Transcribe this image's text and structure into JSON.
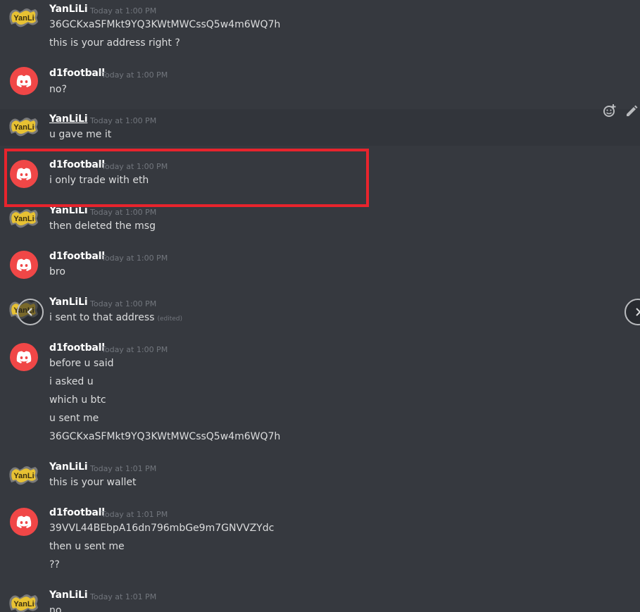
{
  "users": {
    "yanlili": {
      "name": "YanLiLi",
      "avatar_icon": "yanlili-logo-icon"
    },
    "d1football": {
      "name": "d1football",
      "avatar_icon": "discord-logo-icon"
    }
  },
  "messages": [
    {
      "author": "YanLiLi",
      "time": "Today at 1:00 PM",
      "lines": [
        "36GCKxaSFMkt9YQ3KWtMWCssQ5w4m6WQ7h",
        "this is your address right ?"
      ]
    },
    {
      "author": "d1football",
      "time": "Today at 1:00 PM",
      "lines": [
        "no?"
      ]
    },
    {
      "author": "YanLiLi",
      "time": "Today at 1:00 PM",
      "lines": [
        "u gave me it"
      ]
    },
    {
      "author": "d1football",
      "time": "Today at 1:00 PM",
      "lines": [
        "i only trade with eth"
      ]
    },
    {
      "author": "YanLiLi",
      "time": "Today at 1:00 PM",
      "lines": [
        "then deleted the msg"
      ]
    },
    {
      "author": "d1football",
      "time": "Today at 1:00 PM",
      "lines": [
        "bro"
      ]
    },
    {
      "author": "YanLiLi",
      "time": "Today at 1:00 PM",
      "lines": [
        "i sent to that address"
      ],
      "edited": "(edited)"
    },
    {
      "author": "d1football",
      "time": "Today at 1:00 PM",
      "lines": [
        "before u said",
        "i asked u",
        "which u btc",
        "u sent me",
        "36GCKxaSFMkt9YQ3KWtMWCssQ5w4m6WQ7h"
      ]
    },
    {
      "author": "YanLiLi",
      "time": "Today at 1:01 PM",
      "lines": [
        "this is your wallet"
      ]
    },
    {
      "author": "d1football",
      "time": "Today at 1:01 PM",
      "lines": [
        "39VVL44BEbpA16dn796mbGe9m7GNVVZYdc",
        "then u sent me",
        "??"
      ]
    },
    {
      "author": "YanLiLi",
      "time": "Today at 1:01 PM",
      "lines": [
        "no"
      ]
    }
  ],
  "hover_actions": [
    "add-reaction-icon",
    "edit-pencil-icon"
  ],
  "nav": [
    "chevron-left-icon",
    "chevron-right-icon"
  ],
  "colors": {
    "background": "#36393f",
    "hover_row": "#32353b",
    "highlight_box": "#e8242d",
    "discord_red": "#f04747",
    "text": "#dcddde",
    "timestamp": "#72767d"
  }
}
